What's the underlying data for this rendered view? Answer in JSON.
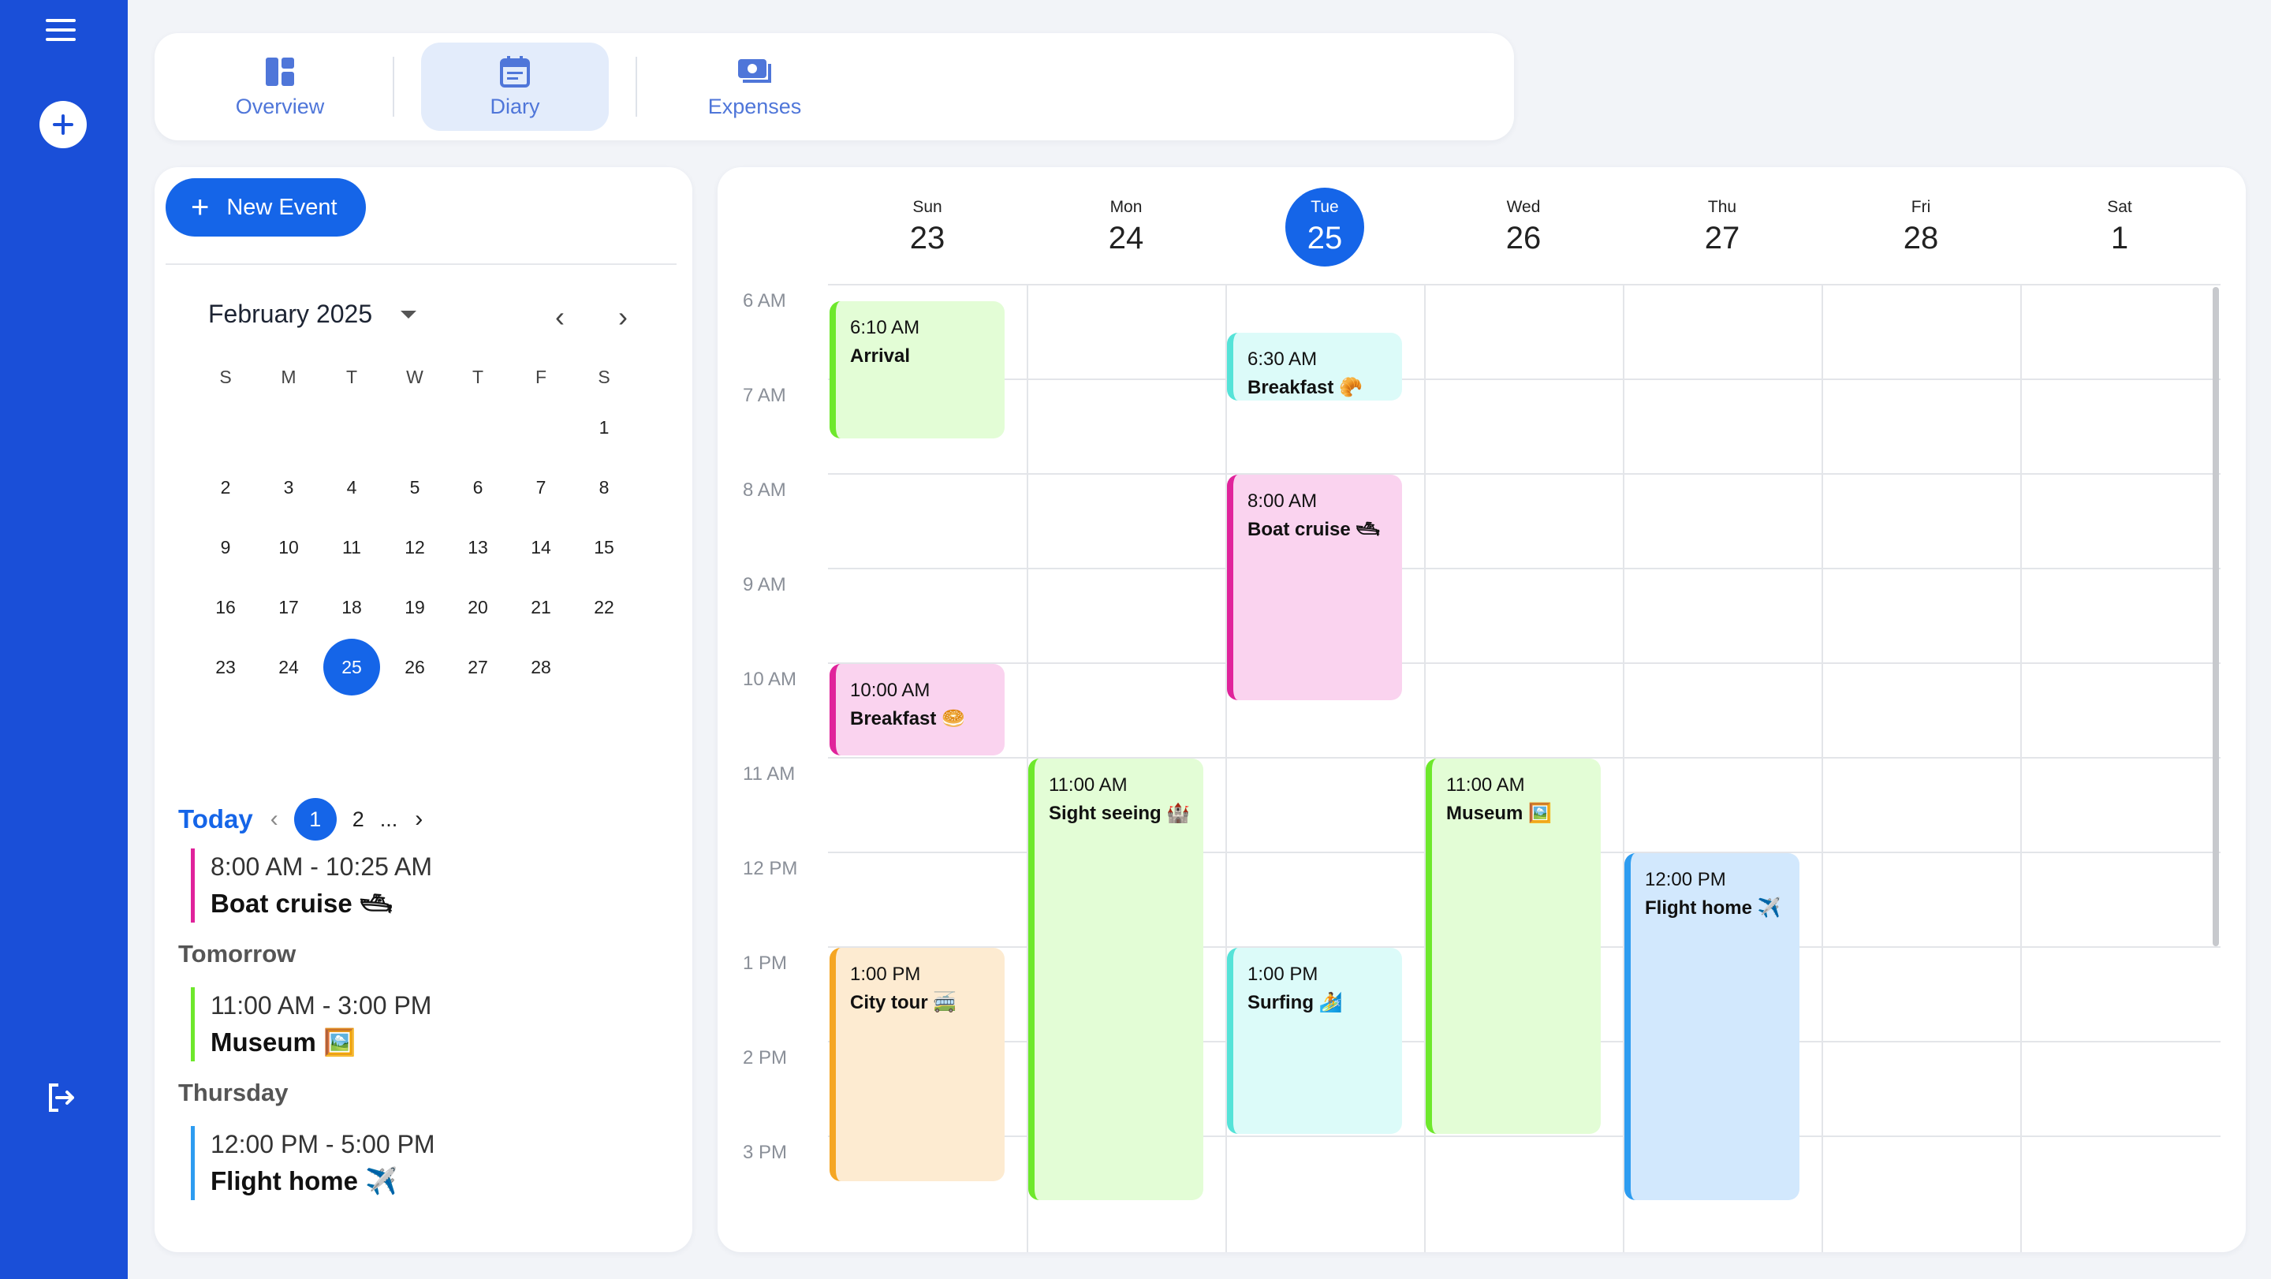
{
  "rail": {
    "icons": [
      "hamburger-menu-icon",
      "add-circle-icon",
      "logout-icon"
    ],
    "color": "#1a4fd8"
  },
  "tabs": [
    {
      "label": "Overview",
      "icon": "dashboard-icon",
      "active": false
    },
    {
      "label": "Diary",
      "icon": "calendar-icon",
      "active": true
    },
    {
      "label": "Expenses",
      "icon": "money-icon",
      "active": false
    }
  ],
  "sidebar": {
    "new_event_label": "New Event",
    "month_label": "February 2025",
    "prev_icon": "‹",
    "next_icon": "›",
    "weekdays": [
      "S",
      "M",
      "T",
      "W",
      "T",
      "F",
      "S"
    ],
    "days": [
      [
        "",
        "",
        "",
        "",
        "",
        "",
        "1"
      ],
      [
        "2",
        "3",
        "4",
        "5",
        "6",
        "7",
        "8"
      ],
      [
        "9",
        "10",
        "11",
        "12",
        "13",
        "14",
        "15"
      ],
      [
        "16",
        "17",
        "18",
        "19",
        "20",
        "21",
        "22"
      ],
      [
        "23",
        "24",
        "25",
        "26",
        "27",
        "28",
        ""
      ]
    ],
    "selected_day": "25"
  },
  "agenda": {
    "today_label": "Today",
    "prev_arrow": "‹",
    "next_arrow": "›",
    "pages": [
      "1",
      "2",
      "..."
    ],
    "active_page": "1",
    "groups": [
      {
        "label": "",
        "time": "8:00 AM - 10:25 AM",
        "name": "Boat cruise 🛥",
        "color": "#e0239b"
      },
      {
        "label": "Tomorrow",
        "time": "11:00 AM - 3:00 PM",
        "name": "Museum 🖼️",
        "color": "#6ee82c"
      },
      {
        "label": "Thursday",
        "time": "12:00 PM - 5:00 PM",
        "name": "Flight home ✈️",
        "color": "#2d9cf0"
      }
    ]
  },
  "calendar": {
    "days": [
      {
        "name": "Sun",
        "date": "23",
        "today": false
      },
      {
        "name": "Mon",
        "date": "24",
        "today": false
      },
      {
        "name": "Tue",
        "date": "25",
        "today": true
      },
      {
        "name": "Wed",
        "date": "26",
        "today": false
      },
      {
        "name": "Thu",
        "date": "27",
        "today": false
      },
      {
        "name": "Fri",
        "date": "28",
        "today": false
      },
      {
        "name": "Sat",
        "date": "1",
        "today": false
      }
    ],
    "hours": [
      "6 AM",
      "7 AM",
      "8 AM",
      "9 AM",
      "10 AM",
      "11 AM",
      "12 PM",
      "1 PM",
      "2 PM",
      "3 PM"
    ],
    "first_hour": 6,
    "events": [
      {
        "day": 0,
        "start": 6.1667,
        "end": 7.65,
        "time": "6:10 AM",
        "name": "Arrival",
        "bg": "#e3fdd6",
        "border": "#6ee82c"
      },
      {
        "day": 0,
        "start": 10.0,
        "end": 11.0,
        "time": "10:00 AM",
        "name": "Breakfast 🥯",
        "bg": "#fad3ef",
        "border": "#e0239b"
      },
      {
        "day": 0,
        "start": 13.0,
        "end": 15.5,
        "time": "1:00 PM",
        "name": "City tour 🚎",
        "bg": "#fdebd1",
        "border": "#f5a623"
      },
      {
        "day": 1,
        "start": 11.0,
        "end": 15.7,
        "time": "11:00 AM",
        "name": "Sight seeing 🏰",
        "bg": "#e3fdd6",
        "border": "#6ee82c"
      },
      {
        "day": 2,
        "start": 6.5,
        "end": 7.25,
        "time": "6:30 AM",
        "name": "Breakfast 🥐",
        "bg": "#dcfbf9",
        "border": "#55e3d8"
      },
      {
        "day": 2,
        "start": 8.0,
        "end": 10.42,
        "time": "8:00 AM",
        "name": "Boat cruise 🛥",
        "bg": "#fad3ef",
        "border": "#e0239b"
      },
      {
        "day": 2,
        "start": 13.0,
        "end": 15.0,
        "time": "1:00 PM",
        "name": "Surfing 🏄",
        "bg": "#dcfbf9",
        "border": "#55e3d8"
      },
      {
        "day": 3,
        "start": 11.0,
        "end": 15.0,
        "time": "11:00 AM",
        "name": "Museum 🖼️",
        "bg": "#e3fdd6",
        "border": "#6ee82c"
      },
      {
        "day": 4,
        "start": 12.0,
        "end": 15.7,
        "time": "12:00 PM",
        "name": "Flight home ✈️",
        "bg": "#d2e8fd",
        "border": "#2d9cf0"
      }
    ]
  }
}
